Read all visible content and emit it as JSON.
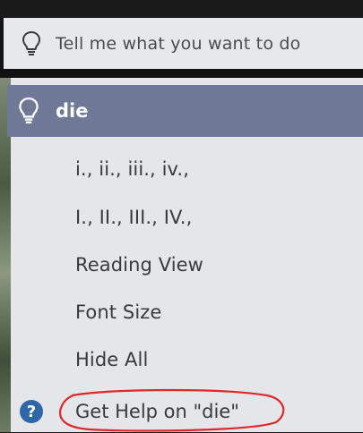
{
  "ribbon": {
    "tell_me_placeholder": "Tell me what you want to do",
    "icon": "lightbulb-icon"
  },
  "dropdown": {
    "query": "die",
    "query_icon": "lightbulb-icon",
    "items": [
      "i., ii., iii., iv.,",
      "I., II., III., IV.,",
      "Reading View",
      "Font Size",
      "Hide All"
    ],
    "help": {
      "label": "Get Help on \"die\"",
      "icon": "help-question-icon",
      "highlight_color": "#e0262b"
    },
    "colors": {
      "query_bar": "#6f7896",
      "panel": "#e4e6ea",
      "help_icon": "#2d67a8"
    }
  }
}
